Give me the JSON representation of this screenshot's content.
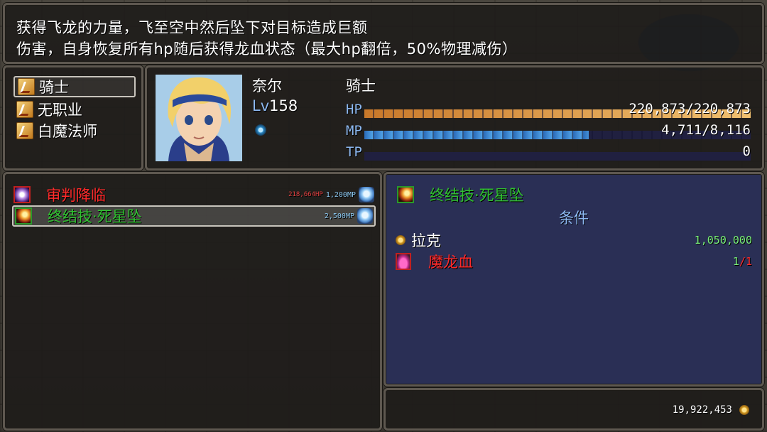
{
  "help": {
    "line1": "获得飞龙的力量，飞至空中然后坠下对目标造成巨额",
    "line2": "伤害，自身恢复所有hp随后获得龙血状态（最大hp翻倍，50%物理减伤）"
  },
  "classes": [
    {
      "label": "骑士",
      "selected": true
    },
    {
      "label": "无职业",
      "selected": false
    },
    {
      "label": "白魔法师",
      "selected": false
    }
  ],
  "actor": {
    "name": "奈尔",
    "level_tag": "Lv",
    "level": "158",
    "class": "骑士",
    "state_icon": "water-state-icon",
    "hp": {
      "label": "HP",
      "value": "220,873/220,873",
      "rate": 1.0
    },
    "mp": {
      "label": "MP",
      "value": "4,711/8,116",
      "rate": 0.58
    },
    "tp": {
      "label": "TP",
      "value": "0",
      "rate": 0.0
    }
  },
  "skills": [
    {
      "name": "审判降临",
      "hp_cost": "218,664HP",
      "mp_cost": "1,200MP",
      "color": "#ff2a2a",
      "icon": "judgement-skill-icon"
    },
    {
      "name": "终结技·死星坠",
      "hp_cost": "",
      "mp_cost": "2,500MP",
      "color": "#30c030",
      "icon": "deathstar-skill-icon"
    }
  ],
  "requirement": {
    "skill_name": "终结技·死星坠",
    "title": "条件",
    "items": [
      {
        "label": "拉克",
        "amount": "1,050,000",
        "icon": "coin-icon"
      },
      {
        "label": "魔龙血",
        "owned": "1",
        "sep": "/",
        "need": "1",
        "icon": "potion-icon"
      }
    ]
  },
  "gold": "19,922,453",
  "colors": {
    "accent": "#8cb8f0",
    "red": "#ff2a2a",
    "green": "#30c030",
    "number_green": "#7af07a"
  }
}
